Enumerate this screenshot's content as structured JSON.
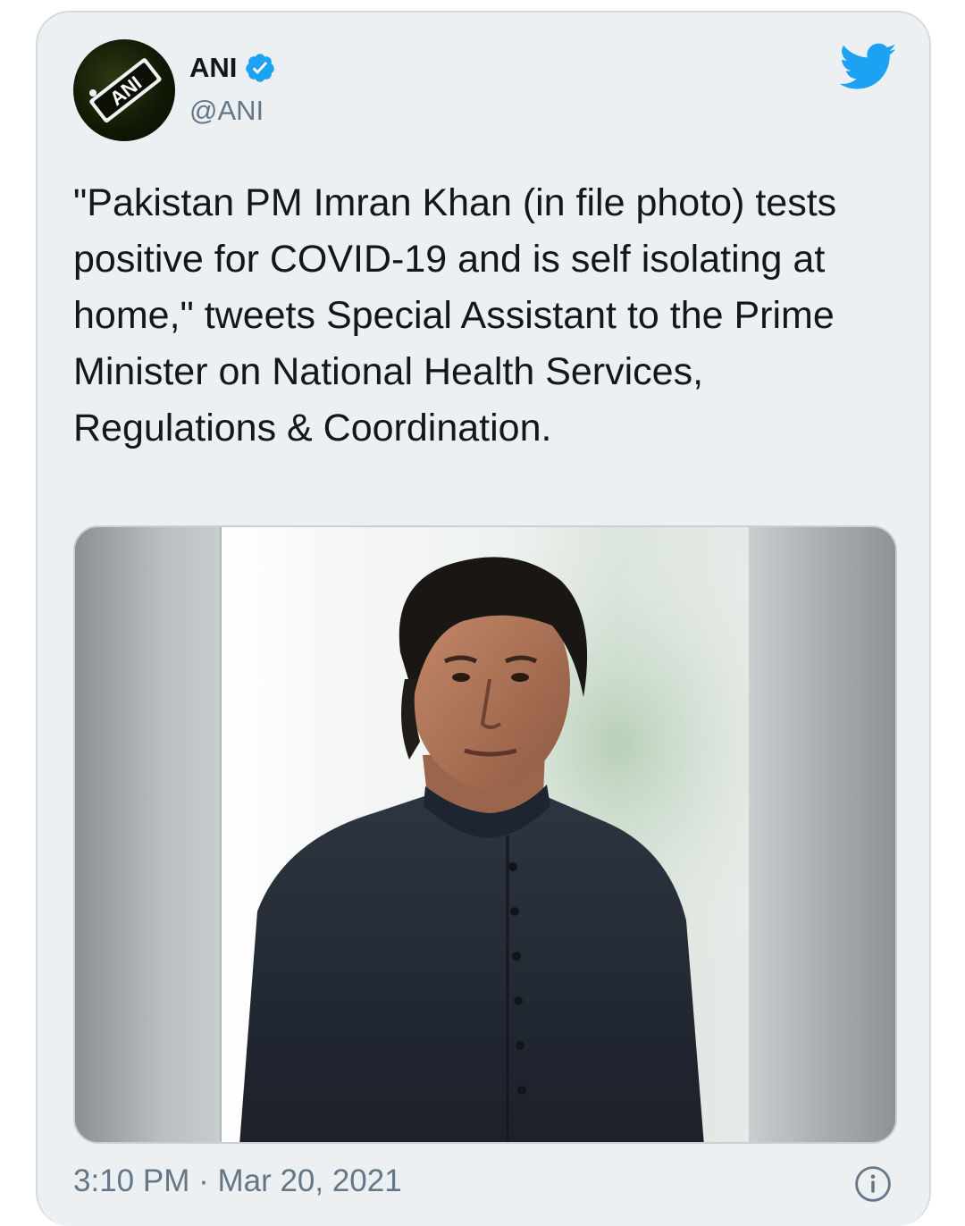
{
  "author": {
    "name": "ANI",
    "handle": "@ANI",
    "avatar_text": "ANI",
    "verified": true
  },
  "tweet": {
    "text": "\"Pakistan PM Imran Khan (in file photo) tests positive for COVID-19 and is self isolating at home,\" tweets Special Assistant to the Prime Minister on National Health Services, Regulations & Coordination.",
    "timestamp": "3:10 PM · Mar 20, 2021"
  },
  "icons": {
    "verified": "verified-badge-icon",
    "brand": "twitter-bird-icon",
    "info": "info-icon"
  },
  "colors": {
    "card_background": "#ecf0f3",
    "text_primary": "#14171a",
    "text_secondary": "#657786",
    "twitter_blue": "#1da1f2"
  }
}
